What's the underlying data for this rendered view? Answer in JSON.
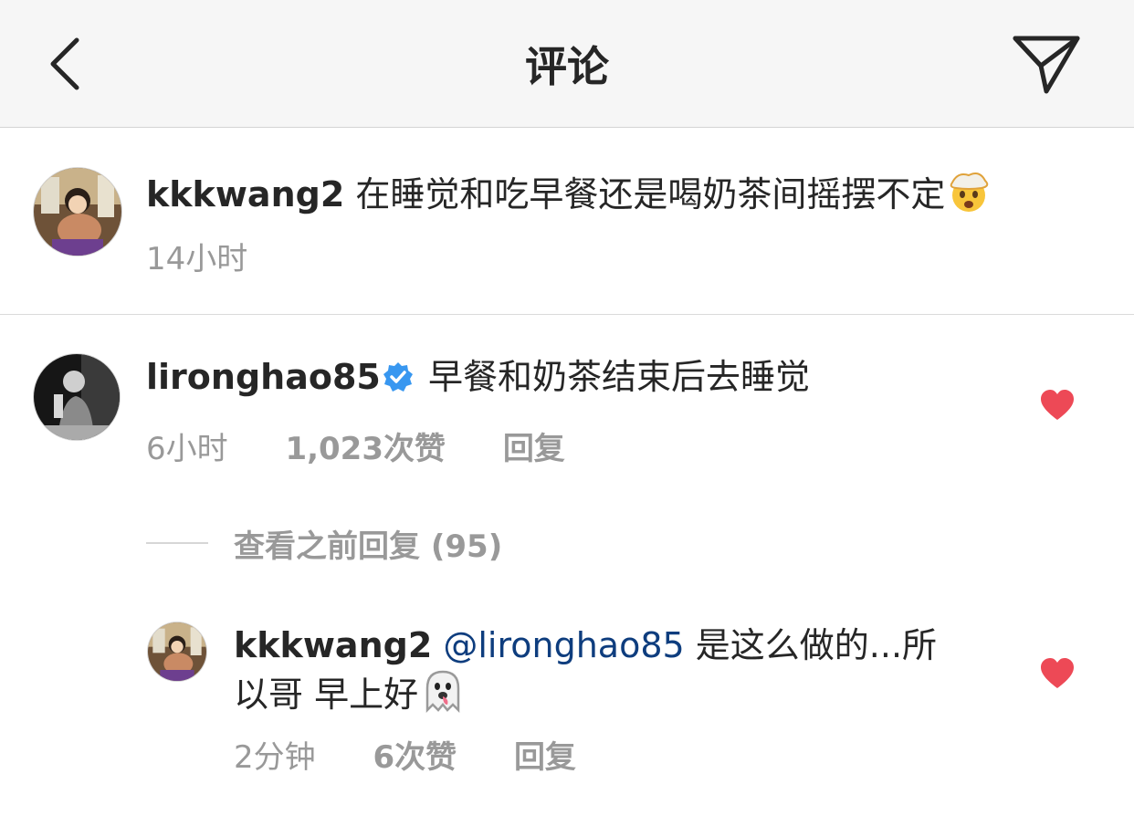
{
  "header": {
    "title": "评论",
    "back_icon": "chevron-left-icon",
    "share_icon": "paper-plane-icon"
  },
  "caption": {
    "username": "kkkwang2",
    "text": "在睡觉和吃早餐还是喝奶茶间摇摆不定",
    "emoji_icon": "exploding-head-emoji-icon",
    "time": "14小时"
  },
  "comments": [
    {
      "username": "lironghao85",
      "verified": true,
      "text": "早餐和奶茶结束后去睡觉",
      "time": "6小时",
      "likes": "1,023次赞",
      "reply": "回复",
      "liked": true
    }
  ],
  "view_replies": {
    "label": "查看之前回复 (95)"
  },
  "replies": [
    {
      "username": "kkkwang2",
      "mention": "@lironghao85",
      "text_line1": "是这么做的...所",
      "text_line2": "以哥 早上好",
      "emoji_icon": "ghost-emoji-icon",
      "time": "2分钟",
      "likes": "6次赞",
      "reply": "回复",
      "liked": true
    }
  ],
  "colors": {
    "header_bg": "#f6f6f6",
    "text": "#262626",
    "meta": "#999999",
    "mention": "#0e3d7e",
    "heart": "#ed4956",
    "verified": "#3897f0"
  }
}
